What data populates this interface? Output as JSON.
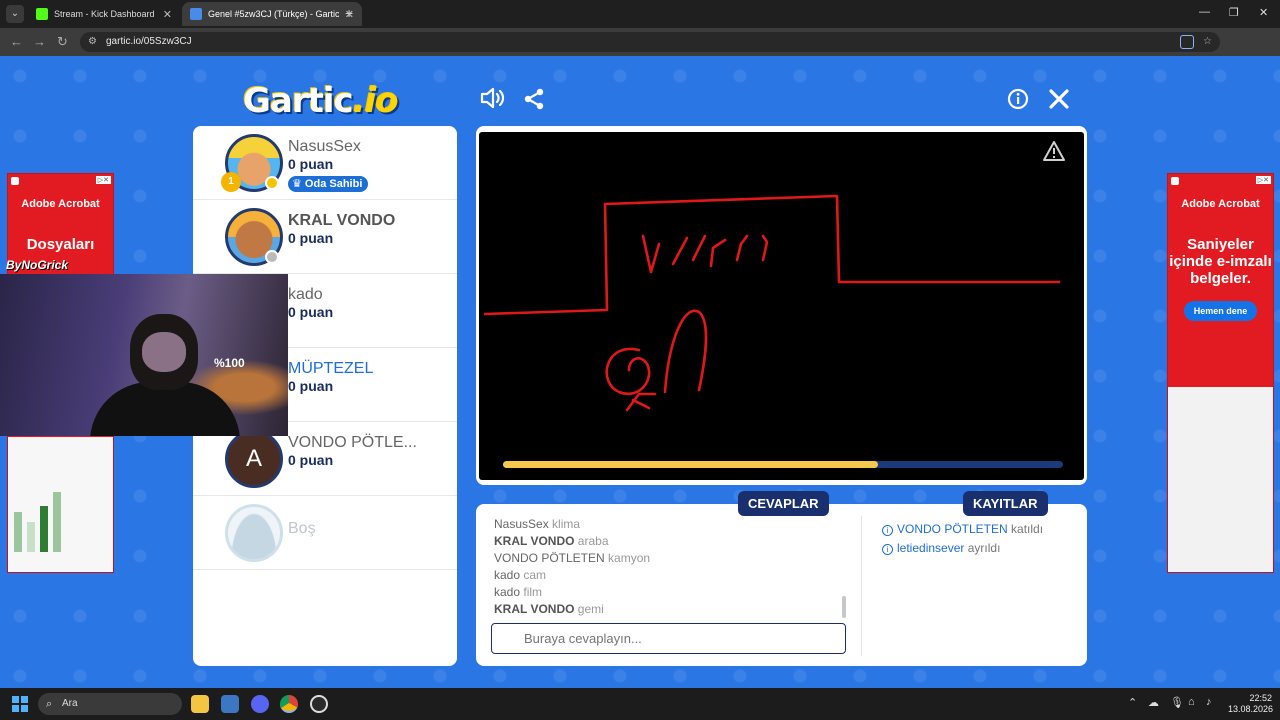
{
  "browser": {
    "tabs": [
      {
        "title": "Stream - Kick Dashboard",
        "favicon_color": "#53fc18"
      },
      {
        "title": "Genel #5zw3CJ (Türkçe) - Gartic",
        "favicon_color": "#4a8ae8"
      }
    ],
    "new_tab": "+",
    "url": "gartic.io/05Szw3CJ",
    "profile_initial": "v"
  },
  "game": {
    "logo_main": "Gartic",
    "logo_suffix": ".io",
    "players": [
      {
        "name": "NasusSex",
        "points": "0 puan",
        "badge": "Oda Sahibi",
        "status_color": "#f5c400"
      },
      {
        "name": "KRAL VONDO",
        "points": "0 puan",
        "status_color": "#bbbbbb"
      },
      {
        "name": "kado",
        "points": "0 puan"
      },
      {
        "name": "MÜPTEZEL",
        "points": "0 puan"
      },
      {
        "name": "VONDO PÖTLE...",
        "points": "0 puan",
        "avatar_letter": "A"
      },
      {
        "name": "Boş"
      }
    ],
    "timer_progress": 0.67,
    "tabs": {
      "answers": "CEVAPLAR",
      "logs": "KAYITLAR"
    },
    "answers": [
      {
        "who": "NasusSex",
        "text": "klima"
      },
      {
        "who": "KRAL VONDO",
        "text": "araba"
      },
      {
        "who": "VONDO PÖTLETEN",
        "text": "kamyon"
      },
      {
        "who": "kado",
        "text": "cam"
      },
      {
        "who": "kado",
        "text": "film"
      },
      {
        "who": "KRAL VONDO",
        "text": "gemi"
      }
    ],
    "logs": [
      {
        "who": "VONDO PÖTLETEN",
        "text": "katıldı"
      },
      {
        "who": "letiedinsever",
        "text": "ayrıldı"
      }
    ],
    "answer_placeholder": "Buraya cevaplayın..."
  },
  "ads": {
    "left": {
      "brand": "Adobe Acrobat",
      "headline": "Dosyaları"
    },
    "right": {
      "brand": "Adobe Acrobat",
      "headline": "Saniyeler içinde e-imzalı belgeler.",
      "cta": "Hemen dene"
    }
  },
  "stream_overlay": {
    "tag": "ByNoGrick",
    "sign": "%100"
  },
  "taskbar": {
    "search": "Ara",
    "time": "22:52",
    "date": "13.08.2026"
  }
}
